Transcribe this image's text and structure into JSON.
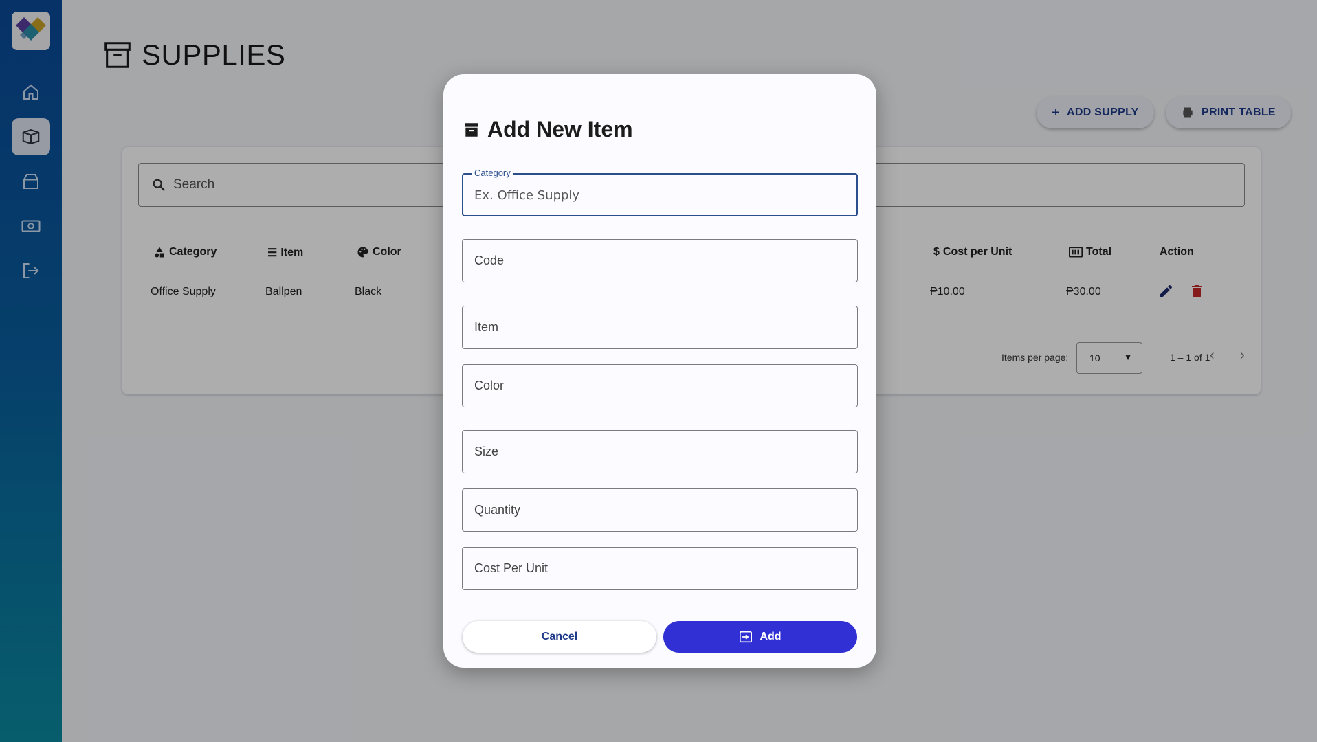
{
  "sidebar": {
    "items": [
      {
        "name": "home",
        "icon": "home-icon"
      },
      {
        "name": "supplies",
        "icon": "box-icon",
        "active": true
      },
      {
        "name": "inventory",
        "icon": "drawer-icon"
      },
      {
        "name": "payments",
        "icon": "money-icon"
      },
      {
        "name": "logout",
        "icon": "logout-icon"
      }
    ]
  },
  "page": {
    "title": "SUPPLIES",
    "add_supply_label": "ADD SUPPLY",
    "print_table_label": "PRINT TABLE",
    "search_placeholder": "Search"
  },
  "table": {
    "columns": [
      "Category",
      "Item",
      "Color",
      "Cost per Unit",
      "Total",
      "Action"
    ],
    "rows": [
      {
        "category": "Office Supply",
        "item": "Ballpen",
        "color": "Black",
        "cost_per_unit": "₱10.00",
        "total": "₱30.00"
      }
    ],
    "items_per_page_label": "Items per page:",
    "items_per_page_value": "10",
    "range_label": "1 – 1 of 1"
  },
  "dialog": {
    "title": "Add New Item",
    "fields": {
      "category_label": "Category",
      "category_placeholder": "Ex. Office Supply",
      "code": "Code",
      "item": "Item",
      "color": "Color",
      "size": "Size",
      "quantity": "Quantity",
      "cost_per_unit": "Cost Per Unit"
    },
    "cancel_label": "Cancel",
    "add_label": "Add"
  },
  "colors": {
    "accent": "#3130d4",
    "primary_text": "#1e3a8a",
    "delete": "#c62828"
  }
}
